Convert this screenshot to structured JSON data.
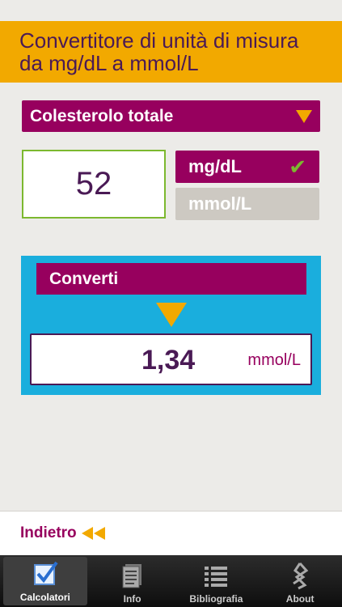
{
  "header": {
    "title": "Convertitore di unità di misura da mg/dL a mmol/L"
  },
  "selector": {
    "label": "Colesterolo totale"
  },
  "input": {
    "value": "52"
  },
  "units": {
    "mg_label": "mg/dL",
    "mmol_label": "mmol/L",
    "selected": "mg/dL"
  },
  "convert": {
    "button_label": "Converti",
    "result_value": "1,34",
    "result_unit": "mmol/L"
  },
  "nav": {
    "back_label": "Indietro"
  },
  "tabs": [
    {
      "label": "Calcolatori",
      "icon": "checkbox-icon",
      "active": true
    },
    {
      "label": "Info",
      "icon": "document-icon",
      "active": false
    },
    {
      "label": "Bibliografia",
      "icon": "list-icon",
      "active": false
    },
    {
      "label": "About",
      "icon": "logo-icon",
      "active": false
    }
  ],
  "colors": {
    "accent": "#f2a900",
    "brand": "#97005e",
    "panel": "#1aaedd",
    "check": "#7cb82f"
  }
}
